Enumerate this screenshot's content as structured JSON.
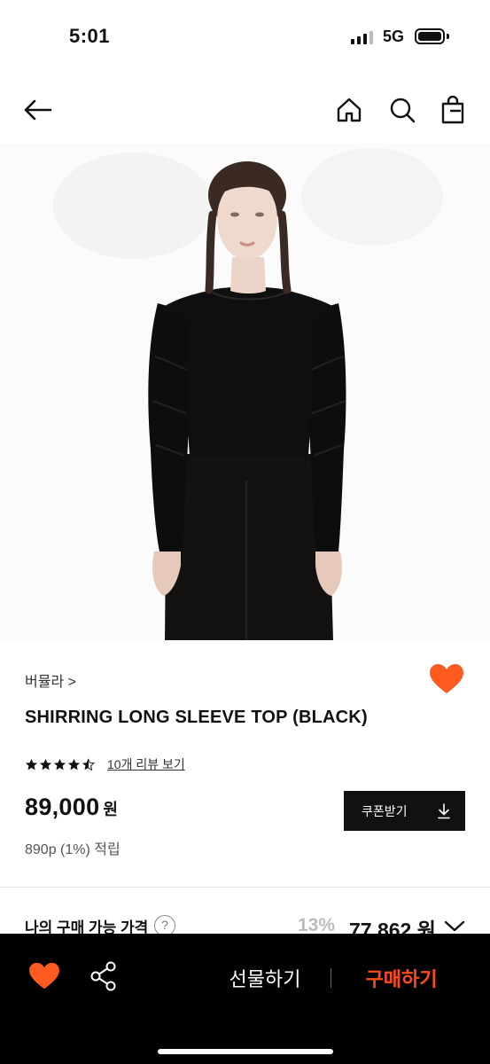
{
  "status": {
    "time": "5:01",
    "network": "5G"
  },
  "nav": {
    "icons": [
      "back-arrow-icon",
      "home-icon",
      "search-icon",
      "shopping-bag-icon"
    ]
  },
  "product": {
    "brand": "버뮬라 >",
    "title": "SHIRRING LONG SLEEVE TOP (BLACK)",
    "rating": 4.5,
    "review_link": "10개 리뷰 보기",
    "price": "89,000",
    "price_unit": "원",
    "points": "890p (1%) 적립",
    "coupon_label": "쿠폰받기",
    "wishlisted": true
  },
  "my_price": {
    "label": "나의 구매 가능 가격",
    "help": "?",
    "discount": "13%",
    "price": "77,862 원"
  },
  "bottom_bar": {
    "gift_label": "선물하기",
    "buy_label": "구매하기"
  },
  "colors": {
    "accent": "#ff5a1f",
    "buy_text": "#ff4b17",
    "bottom_bar_bg": "#000000",
    "coupon_bg": "#111111"
  }
}
